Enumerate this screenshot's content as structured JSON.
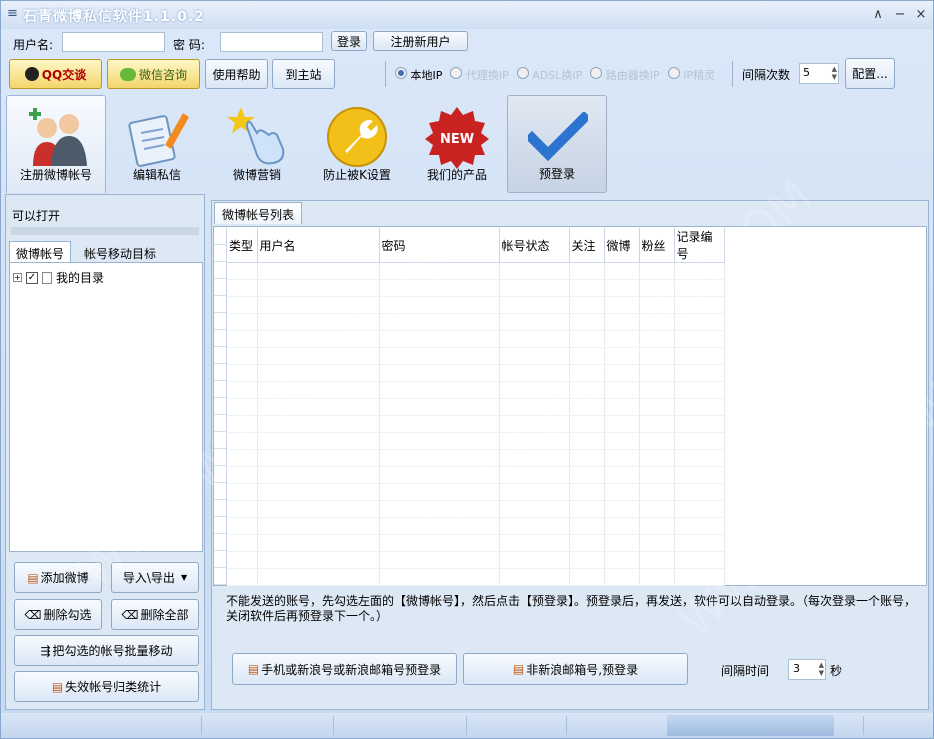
{
  "window": {
    "title": "石青微博私信软件1.1.0.2",
    "menu_icon": "menu-icon",
    "controls": [
      "∧",
      "−",
      "×"
    ]
  },
  "login": {
    "username_label": "用户名:",
    "password_label": "密  码:",
    "login_button": "登录",
    "register_button": "注册新用户",
    "username_value": "",
    "password_value": ""
  },
  "toolbar_top": {
    "qq_button": "QQ交谈",
    "wechat_button": "微信咨询",
    "help_button": "使用帮助",
    "site_button": "到主站",
    "radios": [
      {
        "label": "本地IP",
        "checked": true
      },
      {
        "label": "代理换IP",
        "checked": false
      },
      {
        "label": "ADSL换IP",
        "checked": false
      },
      {
        "label": "路由器换IP",
        "checked": false
      },
      {
        "label": "IP精灵",
        "checked": false
      }
    ],
    "interval_label": "间隔次数",
    "interval_value": "5",
    "config_button": "配置..."
  },
  "tools": [
    {
      "label": "注册微博帐号",
      "icon": "users-icon"
    },
    {
      "label": "编辑私信",
      "icon": "edit-doc-icon"
    },
    {
      "label": "微博营销",
      "icon": "hand-star-icon"
    },
    {
      "label": "防止被K设置",
      "icon": "wrench-icon"
    },
    {
      "label": "我们的产品",
      "icon": "new-badge-icon"
    },
    {
      "label": "预登录",
      "icon": "checkmark-icon"
    }
  ],
  "left": {
    "section_title": "可以打开",
    "tabs": [
      "微博帐号",
      "帐号移动目标"
    ],
    "tree": {
      "root": "我的目录",
      "checked": true
    },
    "buttons": {
      "add": "添加微博",
      "import_export": "导入\\导出",
      "delete_checked": "删除勾选",
      "delete_all": "删除全部",
      "batch_move": "把勾选的帐号批量移动",
      "invalid_stats": "失效帐号归类统计"
    }
  },
  "main": {
    "tab": "微博帐号列表",
    "columns": [
      "类型",
      "用户名",
      "密码",
      "帐号状态",
      "关注",
      "微博",
      "粉丝",
      "记录编号"
    ],
    "rows": [],
    "notice": "不能发送的账号，先勾选左面的【微博帐号】，然后点击【预登录】。预登录后，再发送，软件可以自动登录。（每次登录一个账号，关闭软件后再预登录下一个。）",
    "btn_phone": "手机或新浪号或新浪邮箱号预登录",
    "btn_non_sina": "非新浪邮箱号,预登录",
    "interval_label": "间隔时间",
    "interval_value": "3",
    "interval_unit": "秒"
  },
  "watermark": "WWW.WEIDOWN.COM"
}
